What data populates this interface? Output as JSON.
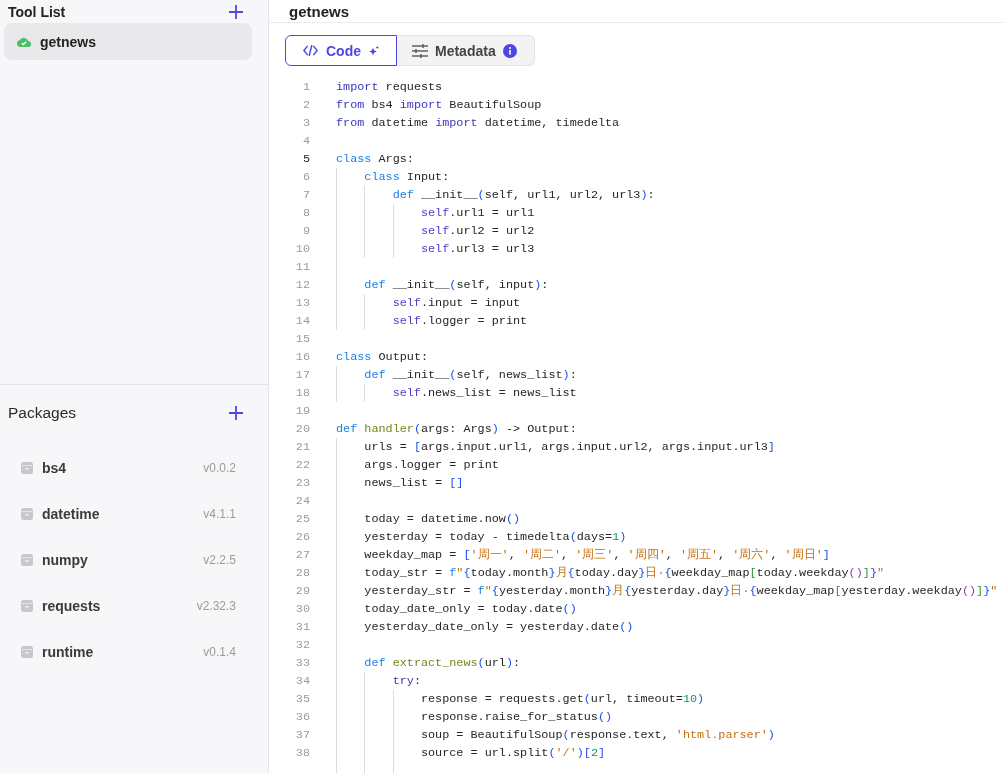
{
  "sidebar": {
    "title": "Tool List",
    "tools": [
      {
        "name": "getnews",
        "selected": true
      }
    ]
  },
  "packages": {
    "title": "Packages",
    "items": [
      {
        "name": "bs4",
        "version": "v0.0.2"
      },
      {
        "name": "datetime",
        "version": "v4.1.1"
      },
      {
        "name": "numpy",
        "version": "v2.2.5"
      },
      {
        "name": "requests",
        "version": "v2.32.3"
      },
      {
        "name": "runtime",
        "version": "v0.1.4"
      }
    ]
  },
  "main": {
    "title": "getnews",
    "tabs": [
      {
        "label": "Code",
        "kind": "code",
        "selected": true
      },
      {
        "label": "Metadata",
        "kind": "metadata",
        "selected": false
      }
    ]
  },
  "code": {
    "lines": [
      {
        "number": "1",
        "current": false,
        "tokens": [
          {
            "text": "import",
            "kind": "keyword"
          },
          {
            "text": " requests",
            "kind": "text"
          }
        ]
      },
      {
        "number": "2",
        "current": false,
        "tokens": [
          {
            "text": "from",
            "kind": "keyword"
          },
          {
            "text": " bs4 ",
            "kind": "text"
          },
          {
            "text": "import",
            "kind": "keyword"
          },
          {
            "text": " BeautifulSoup",
            "kind": "text"
          }
        ]
      },
      {
        "number": "3",
        "current": false,
        "tokens": [
          {
            "text": "from",
            "kind": "keyword"
          },
          {
            "text": " datetime ",
            "kind": "text"
          },
          {
            "text": "import",
            "kind": "keyword"
          },
          {
            "text": " datetime, timedelta",
            "kind": "text"
          }
        ]
      },
      {
        "number": "4",
        "current": false
      },
      {
        "number": "5",
        "current": true,
        "tokens": [
          {
            "text": "class",
            "kind": "storage"
          },
          {
            "text": " Args:",
            "kind": "text"
          }
        ]
      },
      {
        "number": "6",
        "current": false,
        "tokens": [
          {
            "text": "    class",
            "kind": "storage"
          },
          {
            "text": " Input:",
            "kind": "text"
          }
        ]
      },
      {
        "number": "7",
        "current": false,
        "tokens": [
          {
            "text": "        def",
            "kind": "storage"
          },
          {
            "text": " __init__",
            "kind": "text"
          },
          {
            "text": "(",
            "kind": "bracket1"
          },
          {
            "text": "self, url1, url2, url3",
            "kind": "text"
          },
          {
            "text": ")",
            "kind": "bracket1"
          },
          {
            "text": ":",
            "kind": "text"
          }
        ]
      },
      {
        "number": "8",
        "current": false,
        "tokens": [
          {
            "text": "            self",
            "kind": "variable"
          },
          {
            "text": ".url1 = url1",
            "kind": "text"
          }
        ]
      },
      {
        "number": "9",
        "current": false,
        "tokens": [
          {
            "text": "            self",
            "kind": "variable"
          },
          {
            "text": ".url2 = url2",
            "kind": "text"
          }
        ]
      },
      {
        "number": "10",
        "current": false,
        "tokens": [
          {
            "text": "            self",
            "kind": "variable"
          },
          {
            "text": ".url3 = url3",
            "kind": "text"
          }
        ]
      },
      {
        "number": "11",
        "current": false
      },
      {
        "number": "12",
        "current": false,
        "tokens": [
          {
            "text": "    def",
            "kind": "storage"
          },
          {
            "text": " __init__",
            "kind": "text"
          },
          {
            "text": "(",
            "kind": "bracket1"
          },
          {
            "text": "self, input",
            "kind": "text"
          },
          {
            "text": ")",
            "kind": "bracket1"
          },
          {
            "text": ":",
            "kind": "text"
          }
        ]
      },
      {
        "number": "13",
        "current": false,
        "tokens": [
          {
            "text": "        self",
            "kind": "variable"
          },
          {
            "text": ".input = input",
            "kind": "text"
          }
        ]
      },
      {
        "number": "14",
        "current": false,
        "tokens": [
          {
            "text": "        self",
            "kind": "variable"
          },
          {
            "text": ".logger = print",
            "kind": "text"
          }
        ]
      },
      {
        "number": "15",
        "current": false
      },
      {
        "number": "16",
        "current": false,
        "tokens": [
          {
            "text": "class",
            "kind": "storage"
          },
          {
            "text": " Output:",
            "kind": "text"
          }
        ]
      },
      {
        "number": "17",
        "current": false,
        "tokens": [
          {
            "text": "    def",
            "kind": "storage"
          },
          {
            "text": " __init__",
            "kind": "text"
          },
          {
            "text": "(",
            "kind": "bracket1"
          },
          {
            "text": "self, news_list",
            "kind": "text"
          },
          {
            "text": ")",
            "kind": "bracket1"
          },
          {
            "text": ":",
            "kind": "text"
          }
        ]
      },
      {
        "number": "18",
        "current": false,
        "tokens": [
          {
            "text": "        self",
            "kind": "variable"
          },
          {
            "text": ".news_list = news_list",
            "kind": "text"
          }
        ]
      },
      {
        "number": "19",
        "current": false
      },
      {
        "number": "20",
        "current": false,
        "tokens": [
          {
            "text": "def ",
            "kind": "storage"
          },
          {
            "text": "handler",
            "kind": "function"
          },
          {
            "text": "(",
            "kind": "bracket1"
          },
          {
            "text": "args: Args",
            "kind": "text"
          },
          {
            "text": ")",
            "kind": "bracket1"
          },
          {
            "text": " -> Output:",
            "kind": "text"
          }
        ]
      },
      {
        "number": "21",
        "current": false,
        "tokens": [
          {
            "text": "    urls = ",
            "kind": "text"
          },
          {
            "text": "[",
            "kind": "bracket1"
          },
          {
            "text": "args.input.url1, args.input.url2, args.input.url3",
            "kind": "text"
          },
          {
            "text": "]",
            "kind": "bracket1"
          }
        ]
      },
      {
        "number": "22",
        "current": false,
        "tokens": [
          {
            "text": "    args.logger = print",
            "kind": "text"
          }
        ]
      },
      {
        "number": "23",
        "current": false,
        "tokens": [
          {
            "text": "    news_list = ",
            "kind": "text"
          },
          {
            "text": "[]",
            "kind": "bracket1"
          }
        ]
      },
      {
        "number": "24",
        "current": false
      },
      {
        "number": "25",
        "current": false,
        "tokens": [
          {
            "text": "    today = datetime.now",
            "kind": "text"
          },
          {
            "text": "()",
            "kind": "bracket1"
          }
        ]
      },
      {
        "number": "26",
        "current": false,
        "tokens": [
          {
            "text": "    yesterday = today - timedelta",
            "kind": "text"
          },
          {
            "text": "(",
            "kind": "bracket1"
          },
          {
            "text": "days=",
            "kind": "text"
          },
          {
            "text": "1",
            "kind": "number"
          },
          {
            "text": ")",
            "kind": "bracket1"
          }
        ]
      },
      {
        "number": "27",
        "current": false,
        "tokens": [
          {
            "text": "    weekday_map = ",
            "kind": "text"
          },
          {
            "text": "[",
            "kind": "bracket1"
          },
          {
            "text": "'周一'",
            "kind": "string"
          },
          {
            "text": ", ",
            "kind": "text"
          },
          {
            "text": "'周二'",
            "kind": "string"
          },
          {
            "text": ", ",
            "kind": "text"
          },
          {
            "text": "'周三'",
            "kind": "string"
          },
          {
            "text": ", ",
            "kind": "text"
          },
          {
            "text": "'周四'",
            "kind": "string"
          },
          {
            "text": ", ",
            "kind": "text"
          },
          {
            "text": "'周五'",
            "kind": "string"
          },
          {
            "text": ", ",
            "kind": "text"
          },
          {
            "text": "'周六'",
            "kind": "string"
          },
          {
            "text": ", ",
            "kind": "text"
          },
          {
            "text": "'周日'",
            "kind": "string"
          },
          {
            "text": "]",
            "kind": "bracket1"
          }
        ]
      },
      {
        "number": "28",
        "current": false,
        "tokens": [
          {
            "text": "    today_str = ",
            "kind": "text"
          },
          {
            "text": "f",
            "kind": "storage"
          },
          {
            "text": "\"",
            "kind": "string"
          },
          {
            "text": "{",
            "kind": "bracket1"
          },
          {
            "text": "today.month",
            "kind": "text"
          },
          {
            "text": "}",
            "kind": "bracket1"
          },
          {
            "text": "月",
            "kind": "string"
          },
          {
            "text": "{",
            "kind": "bracket1"
          },
          {
            "text": "today.day",
            "kind": "text"
          },
          {
            "text": "}",
            "kind": "bracket1"
          },
          {
            "text": "日·",
            "kind": "string"
          },
          {
            "text": "{",
            "kind": "bracket1"
          },
          {
            "text": "weekday_map",
            "kind": "text"
          },
          {
            "text": "[",
            "kind": "bracket2"
          },
          {
            "text": "today.weekday",
            "kind": "text"
          },
          {
            "text": "()",
            "kind": "bracket3"
          },
          {
            "text": "]",
            "kind": "bracket2"
          },
          {
            "text": "}",
            "kind": "bracket1"
          },
          {
            "text": "\"",
            "kind": "string"
          }
        ]
      },
      {
        "number": "29",
        "current": false,
        "tokens": [
          {
            "text": "    yesterday_str = ",
            "kind": "text"
          },
          {
            "text": "f",
            "kind": "storage"
          },
          {
            "text": "\"",
            "kind": "string"
          },
          {
            "text": "{",
            "kind": "bracket1"
          },
          {
            "text": "yesterday.month",
            "kind": "text"
          },
          {
            "text": "}",
            "kind": "bracket1"
          },
          {
            "text": "月",
            "kind": "string"
          },
          {
            "text": "{",
            "kind": "bracket1"
          },
          {
            "text": "yesterday.day",
            "kind": "text"
          },
          {
            "text": "}",
            "kind": "bracket1"
          },
          {
            "text": "日·",
            "kind": "string"
          },
          {
            "text": "{",
            "kind": "bracket1"
          },
          {
            "text": "weekday_map",
            "kind": "text"
          },
          {
            "text": "[",
            "kind": "bracket2"
          },
          {
            "text": "yesterday.weekday",
            "kind": "text"
          },
          {
            "text": "()",
            "kind": "bracket3"
          },
          {
            "text": "]",
            "kind": "bracket2"
          },
          {
            "text": "}",
            "kind": "bracket1"
          },
          {
            "text": "\"",
            "kind": "string"
          }
        ]
      },
      {
        "number": "30",
        "current": false,
        "tokens": [
          {
            "text": "    today_date_only = today.date",
            "kind": "text"
          },
          {
            "text": "()",
            "kind": "bracket1"
          }
        ]
      },
      {
        "number": "31",
        "current": false,
        "tokens": [
          {
            "text": "    yesterday_date_only = yesterday.date",
            "kind": "text"
          },
          {
            "text": "()",
            "kind": "bracket1"
          }
        ]
      },
      {
        "number": "32",
        "current": false
      },
      {
        "number": "33",
        "current": false,
        "tokens": [
          {
            "text": "    def ",
            "kind": "storage"
          },
          {
            "text": "extract_news",
            "kind": "function"
          },
          {
            "text": "(",
            "kind": "bracket1"
          },
          {
            "text": "url",
            "kind": "text"
          },
          {
            "text": ")",
            "kind": "bracket1"
          },
          {
            "text": ":",
            "kind": "text"
          }
        ]
      },
      {
        "number": "34",
        "current": false,
        "tokens": [
          {
            "text": "        try",
            "kind": "keyword"
          },
          {
            "text": ":",
            "kind": "text"
          }
        ]
      },
      {
        "number": "35",
        "current": false,
        "tokens": [
          {
            "text": "            response = requests.get",
            "kind": "text"
          },
          {
            "text": "(",
            "kind": "bracket1"
          },
          {
            "text": "url, timeout=",
            "kind": "text"
          },
          {
            "text": "10",
            "kind": "number"
          },
          {
            "text": ")",
            "kind": "bracket1"
          }
        ]
      },
      {
        "number": "36",
        "current": false,
        "tokens": [
          {
            "text": "            response.raise_for_status",
            "kind": "text"
          },
          {
            "text": "()",
            "kind": "bracket1"
          }
        ]
      },
      {
        "number": "37",
        "current": false,
        "tokens": [
          {
            "text": "            soup = BeautifulSoup",
            "kind": "text"
          },
          {
            "text": "(",
            "kind": "bracket1"
          },
          {
            "text": "response.text, ",
            "kind": "text"
          },
          {
            "text": "'html.parser'",
            "kind": "string"
          },
          {
            "text": ")",
            "kind": "bracket1"
          }
        ]
      },
      {
        "number": "38",
        "current": false,
        "tokens": [
          {
            "text": "            source = url.split",
            "kind": "text"
          },
          {
            "text": "(",
            "kind": "bracket1"
          },
          {
            "text": "'/'",
            "kind": "string"
          },
          {
            "text": ")",
            "kind": "bracket1"
          },
          {
            "text": "[",
            "kind": "bracket1"
          },
          {
            "text": "2",
            "kind": "number"
          },
          {
            "text": "]",
            "kind": "bracket1"
          }
        ]
      }
    ]
  }
}
